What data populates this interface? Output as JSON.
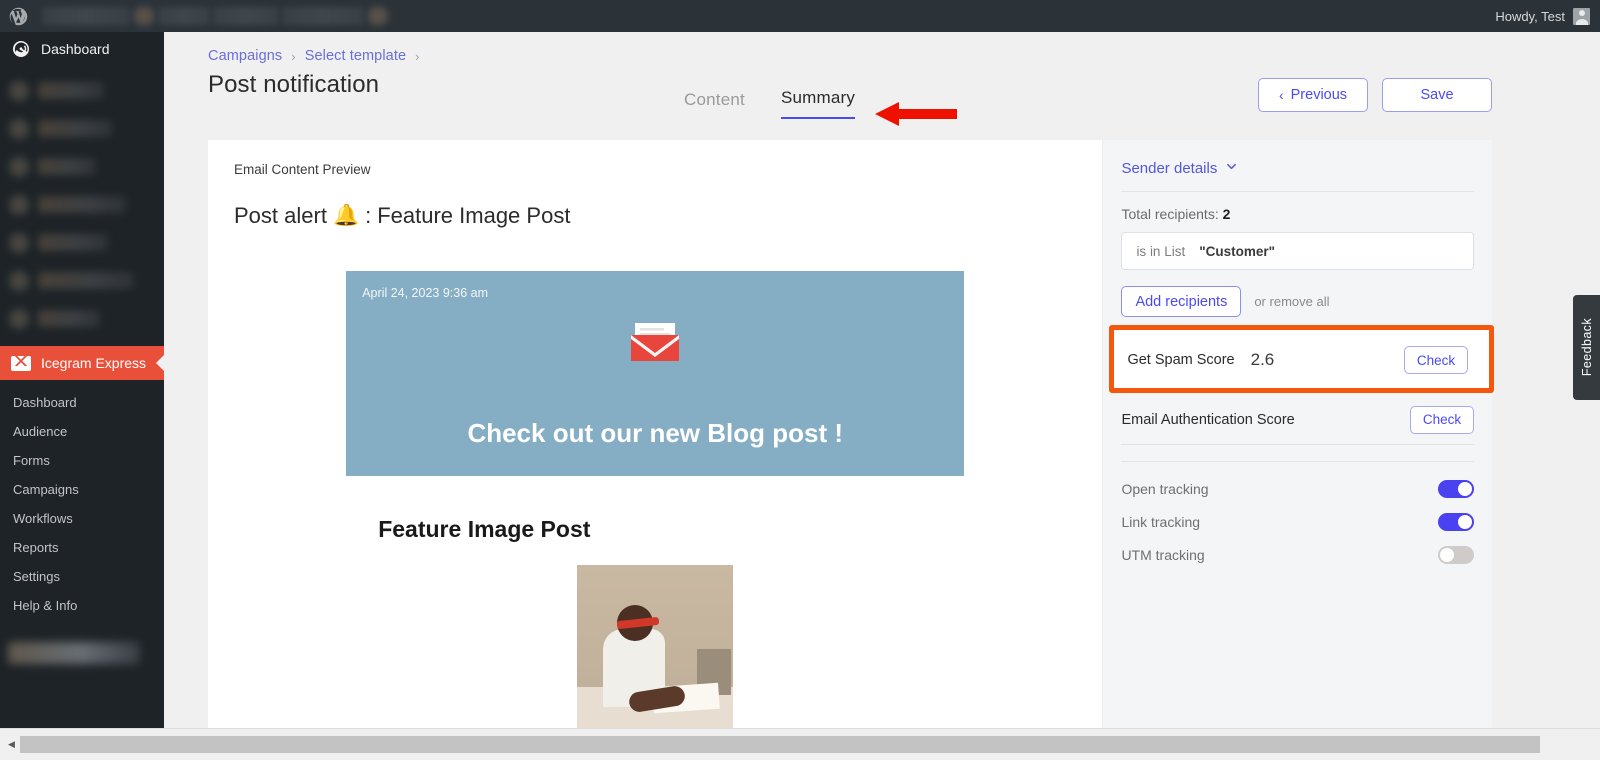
{
  "adminbar": {
    "logo_icon": "wordpress-logo-icon",
    "greeting": "Howdy, Test",
    "avatar_icon": "user-avatar-icon"
  },
  "adminmenu": {
    "dashboard_label": "Dashboard",
    "dashboard_icon": "gauge-icon",
    "active_plugin": {
      "label": "Icegram Express",
      "icon": "envelope-icon",
      "color": "#e8503a"
    },
    "submenu": [
      {
        "label": "Dashboard"
      },
      {
        "label": "Audience"
      },
      {
        "label": "Forms"
      },
      {
        "label": "Campaigns"
      },
      {
        "label": "Workflows"
      },
      {
        "label": "Reports"
      },
      {
        "label": "Settings"
      },
      {
        "label": "Help & Info"
      }
    ]
  },
  "header": {
    "breadcrumb": [
      {
        "label": "Campaigns"
      },
      {
        "label": "Select template"
      }
    ],
    "separator": "›",
    "title": "Post notification",
    "tabs": [
      {
        "label": "Content",
        "active": false
      },
      {
        "label": "Summary",
        "active": true
      }
    ],
    "annotation": {
      "type": "arrow",
      "color": "#ef1100",
      "points_to": "Summary"
    },
    "actions": {
      "previous_label": "Previous",
      "previous_icon": "chevron-left-icon",
      "save_label": "Save"
    }
  },
  "preview": {
    "section_label": "Email Content Preview",
    "subject_prefix": "Post alert",
    "subject_emoji": "🔔",
    "subject_separator": ":",
    "subject_post": "Feature Image Post",
    "hero": {
      "date": "April 24, 2023 9:36 am",
      "icon": "open-envelope-icon",
      "cta": "Check out our new Blog post !",
      "background": "#85aec4"
    },
    "post": {
      "title": "Feature Image Post",
      "image_alt": "person-writing-at-desk-photo"
    }
  },
  "sidebar": {
    "sender_details_label": "Sender details",
    "sender_details_icon": "chevron-down-icon",
    "total_recipients_label": "Total recipients:",
    "total_recipients_value": "2",
    "filter": {
      "condition": "is in List",
      "value": "\"Customer\""
    },
    "add_recipients_label": "Add recipients",
    "or_text": "or",
    "remove_all_label": "remove all",
    "scores": [
      {
        "label": "Get Spam Score",
        "value": "2.6",
        "button": "Check",
        "highlighted": true,
        "highlight_color": "#f4570d"
      },
      {
        "label": "Email Authentication Score",
        "value": "",
        "button": "Check",
        "highlighted": false
      }
    ],
    "tracking": [
      {
        "label": "Open tracking",
        "on": true
      },
      {
        "label": "Link tracking",
        "on": true
      },
      {
        "label": "UTM tracking",
        "on": false
      }
    ],
    "toggle_on_color": "#4a41f0",
    "toggle_off_color": "#cfcbc8"
  },
  "feedback": {
    "label": "Feedback"
  },
  "scrollbar": {
    "arrow_icon": "caret-left-icon"
  }
}
